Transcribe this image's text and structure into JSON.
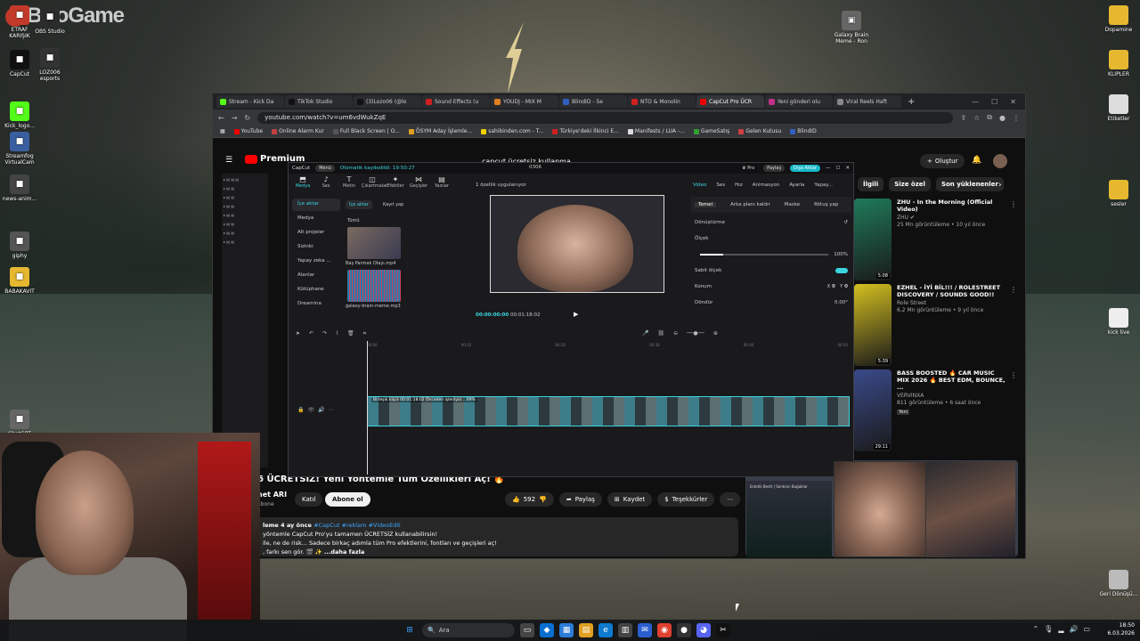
{
  "watermark": "BNoGame",
  "desktop_left": [
    {
      "label": "ETRAF KARIŞIK",
      "color": "#c43a2a"
    },
    {
      "label": "OBS Studio",
      "color": "#2b2b2b"
    },
    {
      "label": "CapCut",
      "color": "#111111"
    },
    {
      "label": "LOZ006 esports",
      "color": "#333333"
    },
    {
      "label": "Kick_logo...",
      "color": "#53fc18"
    },
    {
      "label": "Streamfog VirtualCam",
      "color": "#3a5fa0"
    },
    {
      "label": "news-anim...",
      "color": "#444444"
    },
    {
      "label": "giphy",
      "color": "#555555"
    },
    {
      "label": "BABAKAVIT",
      "color": "#e6b830"
    },
    {
      "label": "ChatGPT Image 6 M...",
      "color": "#666666"
    }
  ],
  "desktop_right": [
    {
      "label": "Dopamine",
      "color": "#e6b830"
    },
    {
      "label": "KLIPLER",
      "color": "#e6b830"
    },
    {
      "label": "Etiketler",
      "color": "#dddddd"
    },
    {
      "label": "sesler",
      "color": "#e6b830"
    },
    {
      "label": "kick live",
      "color": "#eeeeee"
    },
    {
      "label": "Geri Dönüşü...",
      "color": "#bbbbbb"
    }
  ],
  "desktop_mid": {
    "label": "Galaxy Brain Meme - Ron"
  },
  "browser": {
    "tabs": [
      {
        "label": "Stream - Kick Da",
        "color": "#53fc18"
      },
      {
        "label": "TikTok Studio",
        "color": "#111111"
      },
      {
        "label": "(3)Lozo06 (@lo",
        "color": "#111111"
      },
      {
        "label": "Sound Effects (u",
        "color": "#d02020"
      },
      {
        "label": "YOUDJ - MIX M",
        "color": "#e08020"
      },
      {
        "label": "BlindID - Se",
        "color": "#3060c0"
      },
      {
        "label": "NTO & Monolin",
        "color": "#d02020"
      },
      {
        "label": "CapCut Pro ÜCR",
        "color": "#f00000",
        "active": true
      },
      {
        "label": "Yeni gönderi olu",
        "color": "#c0308a"
      },
      {
        "label": "Viral Reels Haft",
        "color": "#888888"
      }
    ],
    "url": "youtube.com/watch?v=um6vdWukZqE",
    "bookmarks": [
      {
        "label": "YouTube",
        "color": "#f00000"
      },
      {
        "label": "Online Alarm Kur",
        "color": "#c04040"
      },
      {
        "label": "Full Black Screen | O...",
        "color": "#555555"
      },
      {
        "label": "ÖSYM Aday İşlemle...",
        "color": "#e0a020"
      },
      {
        "label": "sahibinden.com - T...",
        "color": "#f0d000"
      },
      {
        "label": "Türkiye'deki İlkinci E...",
        "color": "#d02020"
      },
      {
        "label": "Manifests / LUA -...",
        "color": "#dddddd"
      },
      {
        "label": "GameSatış",
        "color": "#30a030"
      },
      {
        "label": "Gelen Kutusu",
        "color": "#d04040"
      },
      {
        "label": "BlindID",
        "color": "#3060c0"
      }
    ]
  },
  "youtube": {
    "logo": "Premium",
    "search_text": "capcut ücretsiz kullanma",
    "create_label": "Oluştur",
    "chips": [
      "İlgili",
      "Size özel",
      "Son yüklenenler"
    ],
    "recommendations": [
      {
        "title": "ZHU - In the Morning (Official Video)",
        "channel": "ZHU ✔",
        "meta": "25 Mn görüntüleme • 10 yıl önce",
        "duration": "5:08",
        "thumb": "#1f7a5a"
      },
      {
        "title": "EZHEL - İYİ BİL!!! / ROLESTREET DISCOVERY / SOUNDS GOOD!!",
        "channel": "Role Street",
        "meta": "6,2 Mn görüntüleme • 9 yıl önce",
        "duration": "5:39",
        "thumb": "#d4c020"
      },
      {
        "title": "BASS BOOSTED 🔥 CAR MUSIC MIX 2026 🔥 BEST EDM, BOUNCE, ...",
        "channel": "VERVINXA",
        "meta": "811 görüntüleme • 6 saat önce",
        "badge": "Yeni",
        "duration": "29:11",
        "thumb": "#3a4a8a"
      }
    ],
    "video_title": "6 ÜCRETSİZ! Yeni Yöntemle Tüm Özellikleri Aç! 🔥",
    "channel_name": "net ARI",
    "channel_subs": "abone",
    "join_label": "Katıl",
    "subscribe_label": "Abone ol",
    "likes": "592",
    "share_label": "Paylaş",
    "save_label": "Kaydet",
    "thanks_label": "Teşekkürler",
    "desc_meta": "leme  4 ay önce",
    "desc_tags": "#CapCut #reklam #VideoEdit",
    "desc_line1": "yöntemle CapCut Pro'yu tamamen ÜCRETSİZ kullanabilirsin!",
    "desc_line2": "ile, ne de risk... Sadece birkaç adımla tüm Pro efektlerini, fontları ve geçişleri aç!",
    "desc_line3": ", farkı sen gör. 🎬 ✨",
    "desc_more": "...daha fazla"
  },
  "capcut": {
    "app_name": "CapCut",
    "menu": "Menü",
    "autosave": "Otomatik kaydedildi: 19:50:27",
    "project_id": "0306",
    "pro_label": "Pro",
    "share_label": "Paylaş",
    "export_label": "Dışa Aktar",
    "tools": [
      {
        "icon": "⬒",
        "label": "Medya",
        "active": true
      },
      {
        "icon": "♪",
        "label": "Ses"
      },
      {
        "icon": "T",
        "label": "Metin"
      },
      {
        "icon": "◫",
        "label": "Çıkartmalar"
      },
      {
        "icon": "✦",
        "label": "Efektler"
      },
      {
        "icon": "⋈",
        "label": "Geçişler"
      },
      {
        "icon": "▤",
        "label": "Yazılar"
      }
    ],
    "side": [
      "İçe aktar",
      "Medya",
      "Alt projeler",
      "Sizinki",
      "Yapay zeka ...",
      "Alanlar",
      "Kütüphane",
      "Dreamina"
    ],
    "media_import": "İçe aktar",
    "media_record": "Kayıt yap",
    "media_all": "Tümü",
    "clip1_label": "Ekleridi",
    "clip1_name": "Baş Parmak Olayı.mp4",
    "clip2_label": "Ekleridi",
    "clip2_name": "galaxy-brain-meme.mp3",
    "feature_notice": "1 özellik uygulanıyor",
    "time_current": "00:00:00:00",
    "time_total": "00:01:18:02",
    "right_tabs": [
      "Video",
      "Ses",
      "Hız",
      "Animasyon",
      "Ayarla",
      "Yapay..."
    ],
    "right_sub": [
      "Temel",
      "Arka planı kaldır",
      "Maske",
      "Rötuş yap"
    ],
    "transform_label": "Dönüştürme",
    "scale_label": "Ölçek",
    "scale_value": "100%",
    "uniform_label": "Sabit ölçek",
    "position_label": "Konum",
    "pos_x": "0",
    "pos_y": "0",
    "rotate_label": "Döndür",
    "rotate_value": "0.00°",
    "ruler": [
      "00:00",
      "00:10",
      "00:20",
      "00:30",
      "00:40",
      "00:50"
    ],
    "track_label": "Birleşik klip3  00:01:18:02  Önceden işleniyor... 69%"
  },
  "webcam_mini_text": "Estetik Bestt | Senkron Buğaklar",
  "taskbar": {
    "search_placeholder": "Ara",
    "time": "18:50",
    "date": "6.03.2026"
  }
}
